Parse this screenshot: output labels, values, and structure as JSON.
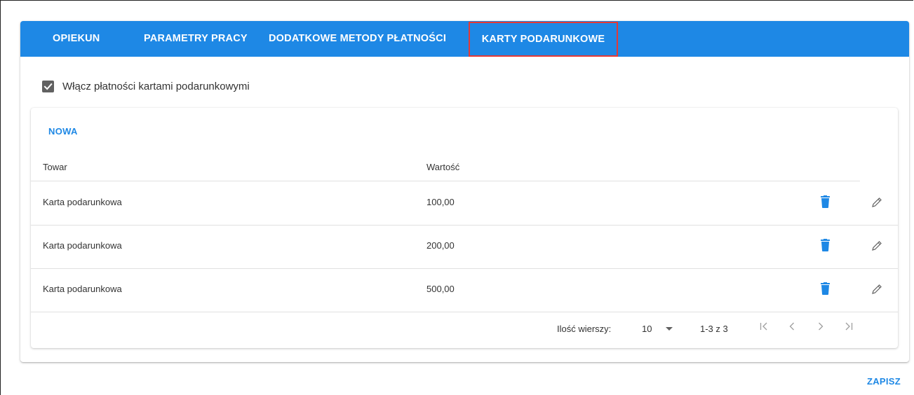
{
  "tabs": [
    {
      "label": "OPIEKUN"
    },
    {
      "label": "PARAMETRY PRACY"
    },
    {
      "label": "DODATKOWE METODY PŁATNOŚCI"
    },
    {
      "label": "KARTY PODARUNKOWE"
    }
  ],
  "settings": {
    "enable_giftcards_label": "Włącz płatności kartami podarunkowymi",
    "enable_giftcards_checked": true
  },
  "table": {
    "new_label": "NOWA",
    "columns": [
      "Towar",
      "Wartość"
    ],
    "rows": [
      {
        "product": "Karta podarunkowa",
        "value": "100,00"
      },
      {
        "product": "Karta podarunkowa",
        "value": "200,00"
      },
      {
        "product": "Karta podarunkowa",
        "value": "500,00"
      }
    ],
    "footer": {
      "rows_per_page_label": "Ilość wierszy:",
      "rows_per_page_value": "10",
      "range_text": "1-3 z 3"
    }
  },
  "save_label": "ZAPISZ",
  "colors": {
    "accent": "#1e88e5",
    "active_tab_outline": "#e53935",
    "checkbox": "#616161"
  },
  "icons": {
    "delete": "trash-icon",
    "edit": "pencil-icon",
    "first_page": "first-page-icon",
    "prev_page": "chevron-left-icon",
    "next_page": "chevron-right-icon",
    "last_page": "last-page-icon",
    "dropdown": "caret-down-icon"
  }
}
